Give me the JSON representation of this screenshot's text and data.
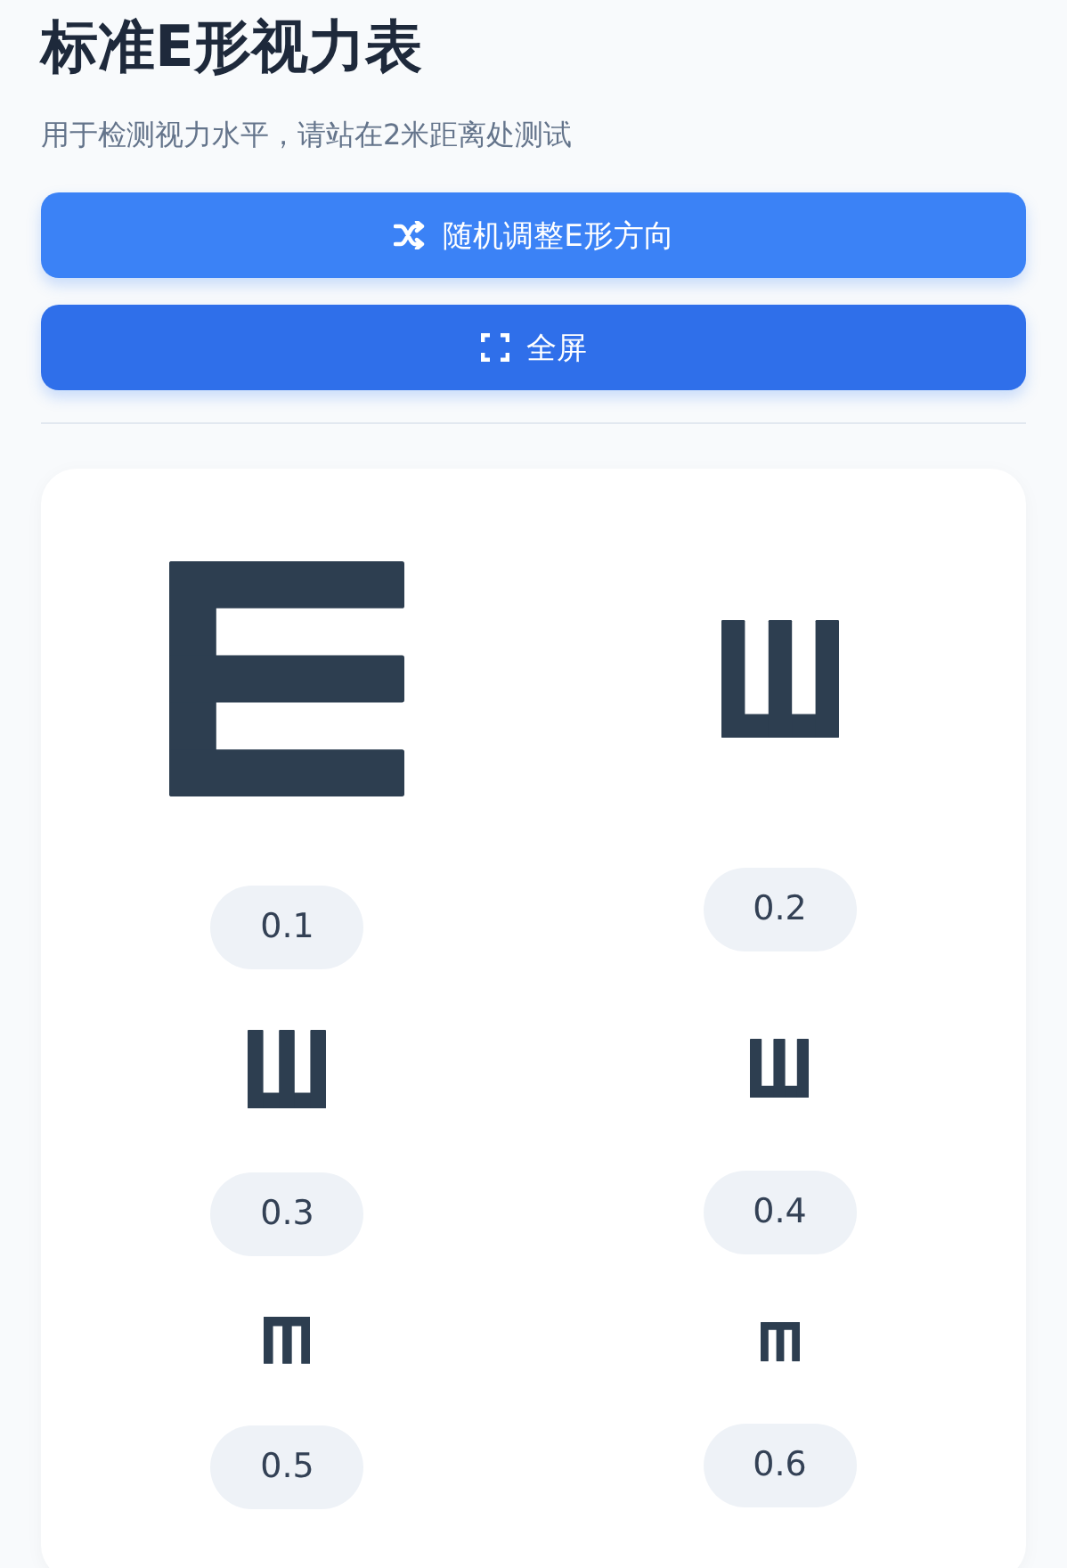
{
  "title": "标准E形视力表",
  "subtitle": "用于检测视力水平，请站在2米距离处测试",
  "buttons": [
    {
      "kind": "shuffle",
      "label": "随机调整E形方向"
    },
    {
      "kind": "fullscreen",
      "label": "全屏"
    }
  ],
  "optotypes": [
    {
      "kind": "right",
      "acuity": "0.1"
    },
    {
      "kind": "up",
      "acuity": "0.2"
    },
    {
      "kind": "up",
      "acuity": "0.3"
    },
    {
      "kind": "up",
      "acuity": "0.4"
    },
    {
      "kind": "down",
      "acuity": "0.5"
    },
    {
      "kind": "down",
      "acuity": "0.6"
    }
  ]
}
